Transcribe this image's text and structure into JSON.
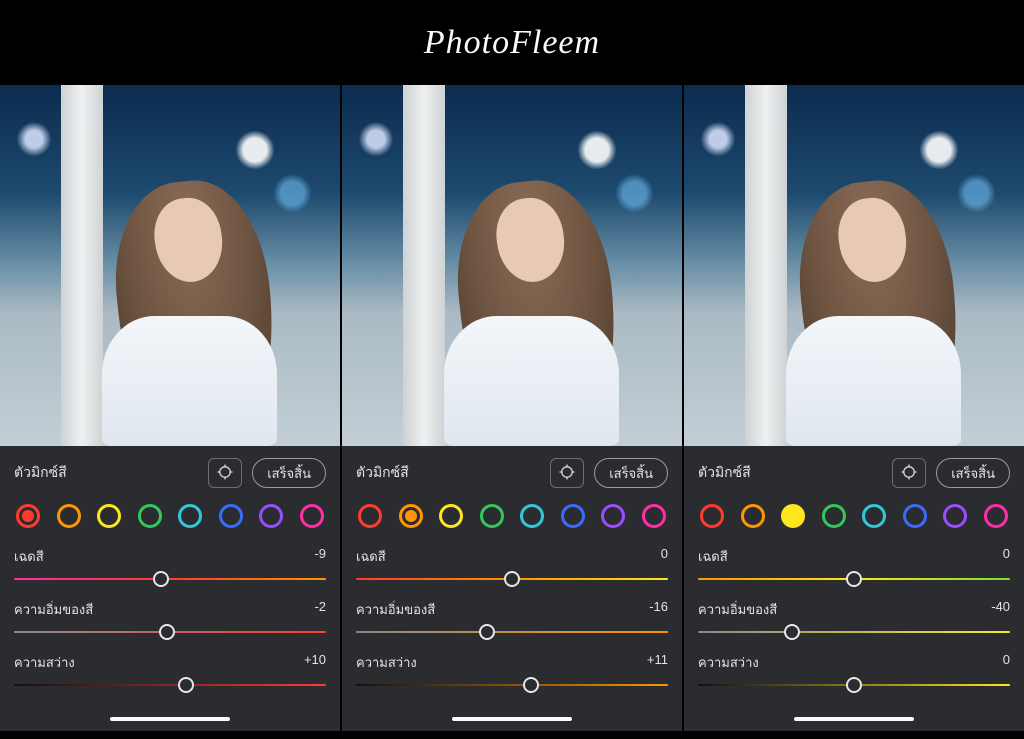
{
  "brand": "PhotoFleem",
  "swatches": [
    {
      "name": "red",
      "color": "#ff3b30"
    },
    {
      "name": "orange",
      "color": "#ff9500"
    },
    {
      "name": "yellow",
      "color": "#ffe620"
    },
    {
      "name": "green",
      "color": "#34c759"
    },
    {
      "name": "aqua",
      "color": "#32c8d9"
    },
    {
      "name": "blue",
      "color": "#3a6bff"
    },
    {
      "name": "purple",
      "color": "#9a4dff"
    },
    {
      "name": "magenta",
      "color": "#ff2ea6"
    }
  ],
  "panels": [
    {
      "title": "ตัวมิกซ์สี",
      "done": "เสร็จสิ้น",
      "active_swatch": 0,
      "filled_swatch": -1,
      "gradient_id": "red",
      "sliders": [
        {
          "label": "เฉดสี",
          "value": "-9",
          "pos": 47
        },
        {
          "label": "ความอิ่มของสี",
          "value": "-2",
          "pos": 49
        },
        {
          "label": "ความสว่าง",
          "value": "+10",
          "pos": 55
        }
      ]
    },
    {
      "title": "ตัวมิกซ์สี",
      "done": "เสร็จสิ้น",
      "active_swatch": 1,
      "filled_swatch": -1,
      "gradient_id": "orange",
      "sliders": [
        {
          "label": "เฉดสี",
          "value": "0",
          "pos": 50
        },
        {
          "label": "ความอิ่มของสี",
          "value": "-16",
          "pos": 42
        },
        {
          "label": "ความสว่าง",
          "value": "+11",
          "pos": 56
        }
      ]
    },
    {
      "title": "ตัวมิกซ์สี",
      "done": "เสร็จสิ้น",
      "active_swatch": 2,
      "filled_swatch": 2,
      "gradient_id": "yellow",
      "sliders": [
        {
          "label": "เฉดสี",
          "value": "0",
          "pos": 50
        },
        {
          "label": "ความอิ่มของสี",
          "value": "-40",
          "pos": 30
        },
        {
          "label": "ความสว่าง",
          "value": "0",
          "pos": 50
        }
      ]
    }
  ],
  "gradients": {
    "red": {
      "hue": "linear-gradient(90deg,#ff2ea6,#ff3b30,#ff9500)",
      "sat": "linear-gradient(90deg,#8a8a8a,#ff3b30)",
      "lum": "linear-gradient(90deg,#111,#ff3b30)"
    },
    "orange": {
      "hue": "linear-gradient(90deg,#ff3b30,#ff9500,#ffe620)",
      "sat": "linear-gradient(90deg,#8a8a8a,#ff9500)",
      "lum": "linear-gradient(90deg,#111,#ff9500)"
    },
    "yellow": {
      "hue": "linear-gradient(90deg,#ff9500,#ffe620,#7adf3a)",
      "sat": "linear-gradient(90deg,#8a8a8a,#ffe620)",
      "lum": "linear-gradient(90deg,#111,#ffe620)"
    }
  }
}
